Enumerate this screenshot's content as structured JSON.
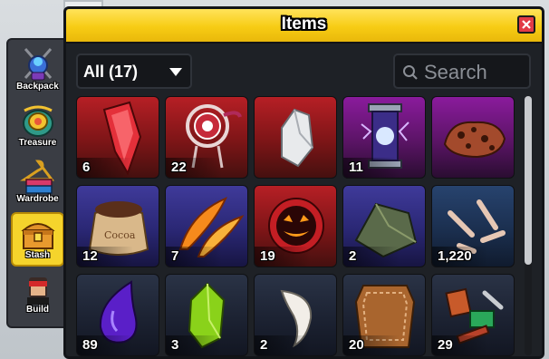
{
  "window": {
    "title": "Items"
  },
  "sidebar": {
    "items": [
      {
        "label": "Backpack",
        "icon": "backpack-icon",
        "active": false
      },
      {
        "label": "Treasure",
        "icon": "treasure-icon",
        "active": false
      },
      {
        "label": "Wardrobe",
        "icon": "wardrobe-icon",
        "active": false
      },
      {
        "label": "Stash",
        "icon": "stash-icon",
        "active": true
      },
      {
        "label": "Build",
        "icon": "build-icon",
        "active": false
      }
    ]
  },
  "filter": {
    "selected": "All (17)"
  },
  "search": {
    "placeholder": "Search",
    "value": ""
  },
  "colors": {
    "accent": "#f7cc14",
    "close": "#e23b46",
    "active_tab": "#f5d42c"
  },
  "items": [
    {
      "name": "red-crystal",
      "count": "6",
      "rarity": "red"
    },
    {
      "name": "dreamcatcher",
      "count": "22",
      "rarity": "red"
    },
    {
      "name": "white-stone",
      "count": "",
      "rarity": "red"
    },
    {
      "name": "lightning-hourglass",
      "count": "11",
      "rarity": "purple"
    },
    {
      "name": "volcanic-rock",
      "count": "",
      "rarity": "purple"
    },
    {
      "name": "cocoa-sack",
      "count": "12",
      "rarity": "indigo"
    },
    {
      "name": "fire-feathers",
      "count": "7",
      "rarity": "indigo"
    },
    {
      "name": "jack-o-lantern-orb",
      "count": "19",
      "rarity": "red"
    },
    {
      "name": "mossy-rock",
      "count": "2",
      "rarity": "indigo"
    },
    {
      "name": "bones",
      "count": "1,220",
      "rarity": "blue"
    },
    {
      "name": "purple-drop",
      "count": "89",
      "rarity": "dark"
    },
    {
      "name": "green-crystal",
      "count": "3",
      "rarity": "dark"
    },
    {
      "name": "white-fang",
      "count": "2",
      "rarity": "dark"
    },
    {
      "name": "leather",
      "count": "20",
      "rarity": "dark"
    },
    {
      "name": "scrap-parts",
      "count": "29",
      "rarity": "dark"
    }
  ]
}
